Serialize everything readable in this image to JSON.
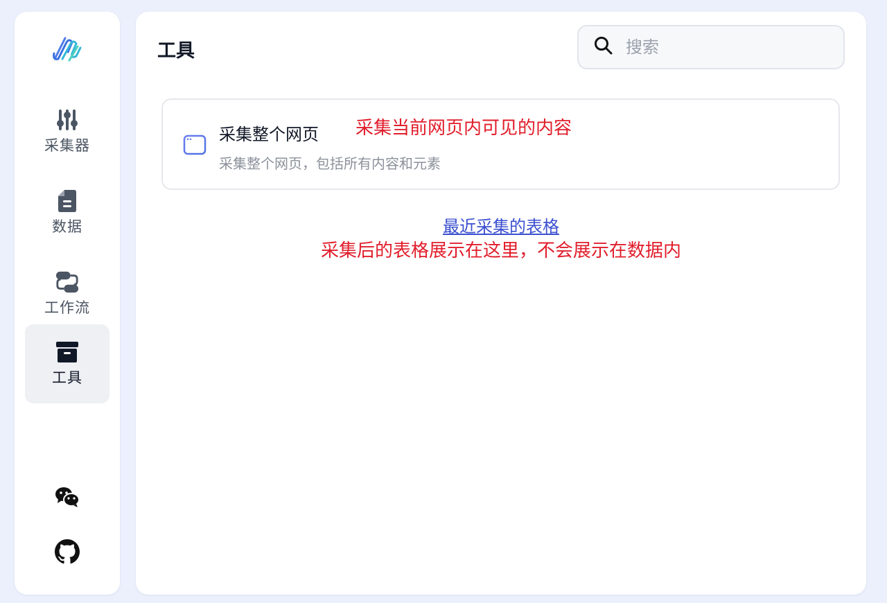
{
  "sidebar": {
    "logo": "app-logo",
    "items": [
      {
        "label": "采集器",
        "icon": "sliders-icon"
      },
      {
        "label": "数据",
        "icon": "document-icon"
      },
      {
        "label": "工作流",
        "icon": "workflow-icon"
      },
      {
        "label": "工具",
        "icon": "archive-box-icon",
        "active": true
      }
    ],
    "bottom": [
      {
        "icon": "wechat-icon"
      },
      {
        "icon": "github-icon"
      }
    ]
  },
  "header": {
    "title": "工具",
    "search": {
      "placeholder": "搜索",
      "value": ""
    }
  },
  "tools": [
    {
      "icon": "browser-window-icon",
      "title": "采集整个网页",
      "description": "采集整个网页，包括所有内容和元素",
      "annotation": "采集当前网页内可见的内容"
    }
  ],
  "recent": {
    "link_label": "最近采集的表格",
    "annotation": "采集后的表格展示在这里，不会展示在数据内"
  },
  "colors": {
    "background": "#ecf0fc",
    "annotation_red": "#e11d2b",
    "link_blue": "#3b4fd0",
    "active_nav": "#eef0f4"
  }
}
